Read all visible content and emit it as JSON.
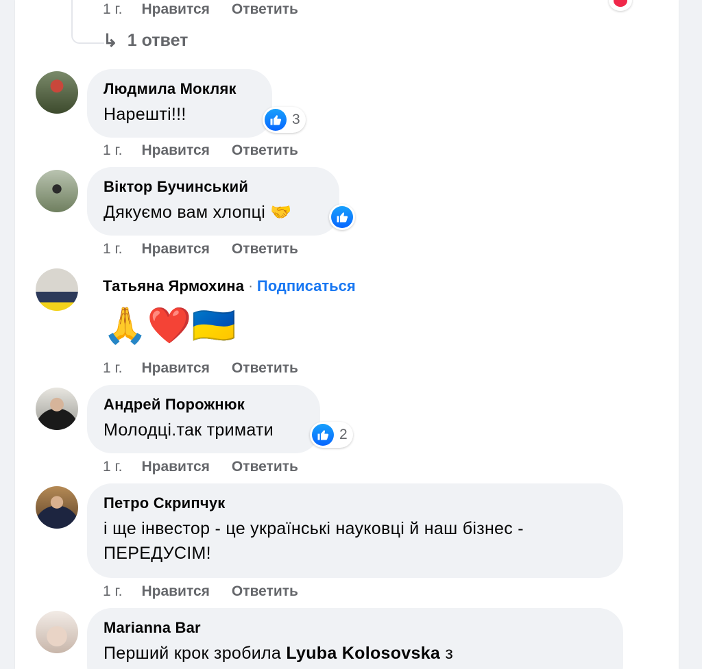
{
  "top_actions": {
    "time": "1 г.",
    "like": "Нравится",
    "reply": "Ответить"
  },
  "replies_link": "1 ответ",
  "comments": [
    {
      "author": "Людмила Мокляк",
      "text": "Нарешті!!!",
      "reactions": "3",
      "time": "1 г.",
      "like": "Нравится",
      "reply": "Ответить"
    },
    {
      "author": "Віктор Бучинський",
      "text": "Дякуємо вам хлопці 🤝",
      "reactions": "",
      "time": "1 г.",
      "like": "Нравится",
      "reply": "Ответить"
    },
    {
      "author": "Татьяна Ярмохина",
      "subscribe": "Подписаться",
      "emoji": "🙏❤️🇺🇦",
      "time": "1 г.",
      "like": "Нравится",
      "reply": "Ответить"
    },
    {
      "author": "Андрей Порожнюк",
      "text": "Молодці.так тримати",
      "reactions": "2",
      "time": "1 г.",
      "like": "Нравится",
      "reply": "Ответить"
    },
    {
      "author": "Петро Скрипчук",
      "text_line1": "і ще інвестор - це українські науковці й наш бізнес -",
      "text_line2": "ПЕРЕДУСІМ!",
      "time": "1 г.",
      "like": "Нравится",
      "reply": "Ответить"
    },
    {
      "author": "Marianna Bar",
      "text_pre": "Перший крок зробила",
      "mention": "Lyuba Kolosovska",
      "text_post": "з"
    }
  ],
  "colors": {
    "link_blue": "#1877f2",
    "bubble_bg": "#f0f2f5",
    "meta_gray": "#65676b",
    "like_blue": "#0866ff"
  },
  "icons": [
    "reply-arrow-icon",
    "like-icon",
    "love-react-icon",
    "avatar"
  ]
}
